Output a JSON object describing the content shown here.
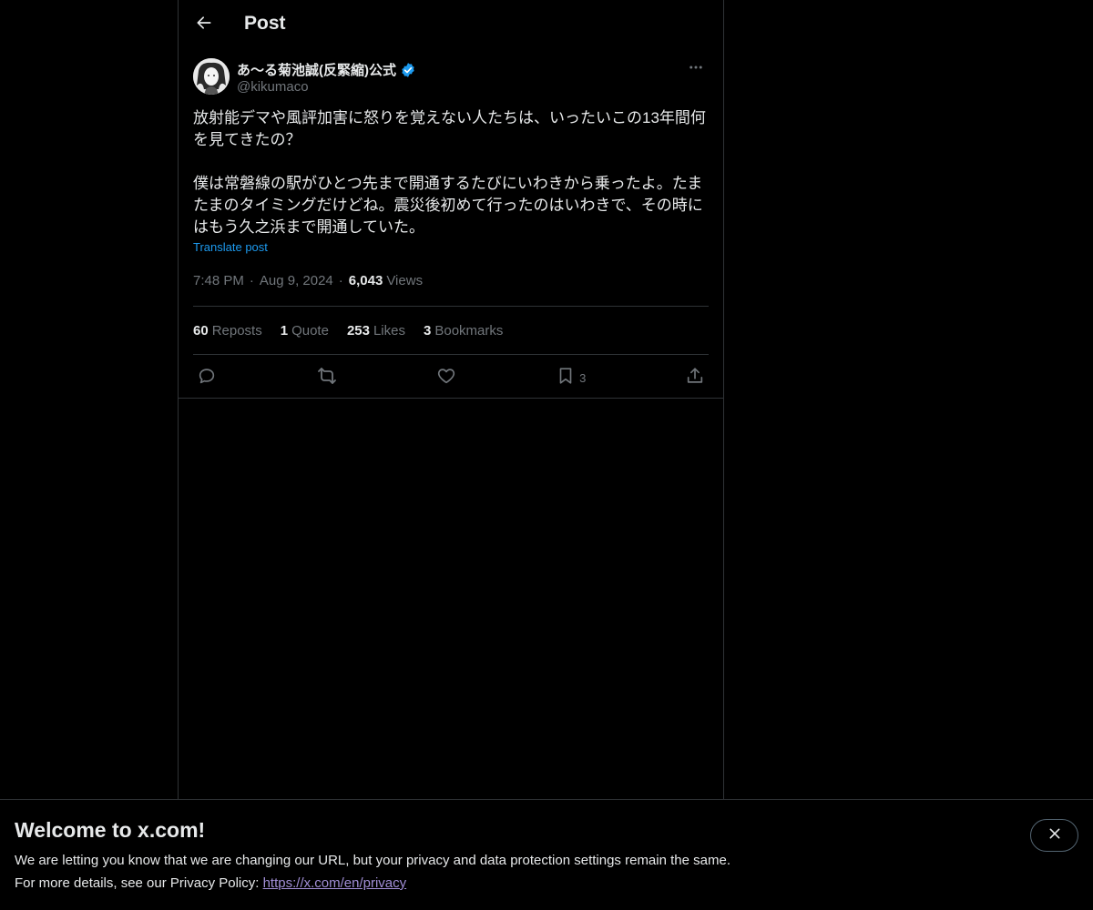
{
  "header": {
    "back_icon": "arrow-left-icon",
    "title": "Post"
  },
  "post": {
    "author": {
      "name": "あ〜る菊池誠(反緊縮)公式",
      "handle": "@kikumaco",
      "verified": true,
      "verified_color": "#1d9bf0"
    },
    "text": "放射能デマや風評加害に怒りを覚えない人たちは、いったいこの13年間何を見てきたの？\n\n僕は常磐線の駅がひとつ先まで開通するたびにいわきから乗ったよ。たまたまのタイミングだけどね。震災後初めて行ったのはいわきで、その時にはもう久之浜まで開通していた。",
    "translate_label": "Translate post",
    "time": "7:48 PM",
    "date": "Aug 9, 2024",
    "views_count": "6,043",
    "views_label": "Views",
    "stats": {
      "reposts_count": "60",
      "reposts_label": "Reposts",
      "quotes_count": "1",
      "quotes_label": "Quote",
      "likes_count": "253",
      "likes_label": "Likes",
      "bookmarks_count": "3",
      "bookmarks_label": "Bookmarks"
    },
    "actions": {
      "bookmark_count": "3"
    }
  },
  "banner": {
    "title": "Welcome to x.com!",
    "line1": "We are letting you know that we are changing our URL, but your privacy and data protection settings remain the same.",
    "line2_prefix": "For more details, see our Privacy Policy: ",
    "link_text": "https://x.com/en/privacy"
  },
  "colors": {
    "background": "#000000",
    "text_primary": "#e7e9ea",
    "text_secondary": "#71767b",
    "accent": "#1d9bf0",
    "border": "#2f3336",
    "link_visited": "#a18ed6"
  }
}
